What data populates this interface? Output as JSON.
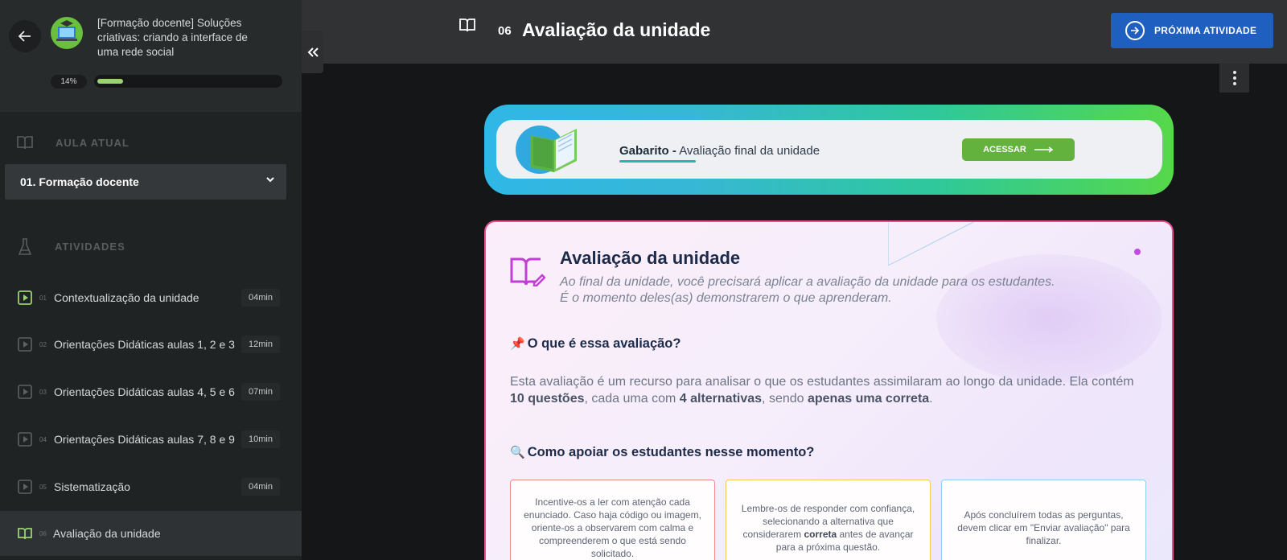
{
  "sidebar": {
    "course_title": "[Formação docente] Soluções criativas: criando a interface de uma rede social",
    "progress_label": "14%",
    "progress_value": 0.14,
    "current_lesson_heading": "AULA ATUAL",
    "current_lesson": "01. Formação docente",
    "activities_heading": "ATIVIDADES",
    "activities": [
      {
        "num": "01",
        "label": "Contextualização da unidade",
        "duration": "04min",
        "icon": "video-play-icon"
      },
      {
        "num": "02",
        "label": "Orientações Didáticas aulas 1, 2 e 3",
        "duration": "12min",
        "icon": "video-play-icon"
      },
      {
        "num": "03",
        "label": "Orientações Didáticas aulas 4, 5 e 6",
        "duration": "07min",
        "icon": "video-play-icon"
      },
      {
        "num": "04",
        "label": "Orientações Didáticas aulas 7, 8 e 9",
        "duration": "10min",
        "icon": "video-play-icon"
      },
      {
        "num": "05",
        "label": "Sistematização",
        "duration": "04min",
        "icon": "video-play-icon"
      },
      {
        "num": "06",
        "label": "Avaliação da unidade",
        "duration": "",
        "icon": "open-book-icon"
      }
    ]
  },
  "header": {
    "unit_number": "06",
    "unit_title": "Avaliação da unidade",
    "next_button": "PRÓXIMA ATIVIDADE"
  },
  "banner": {
    "bold": "Gabarito -",
    "text": "Avaliação final da unidade",
    "button": "ACESSAR"
  },
  "card": {
    "title": "Avaliação da unidade",
    "subtitle_line1": "Ao final da unidade, você precisará aplicar a avaliação da unidade para os estudantes.",
    "subtitle_line2": "É o momento deles(as) demonstrarem o que aprenderam.",
    "q1_emoji": "📌",
    "q1": "O que é essa avaliação?",
    "body_part1": "Esta avaliação é um recurso para analisar o que os estudantes assimilaram ao longo da unidade. Ela contém ",
    "body_bold1": "10 questões",
    "body_part2": ", cada uma com ",
    "body_bold2": "4 alternativas",
    "body_part3": ", sendo ",
    "body_bold3": "apenas uma correta",
    "body_part4": ".",
    "q2_emoji": "🔍",
    "q2": "Como apoiar os estudantes nesse momento?",
    "tip1": "Incentive-os a ler com atenção cada enunciado. Caso haja código ou imagem, oriente-os a observarem com calma e compreenderem o que está sendo solicitado.",
    "tip2_a": "Lembre-os de responder com confiança, selecionando a alternativa que considerarem ",
    "tip2_bold": "correta",
    "tip2_b": " antes de avançar para a próxima questão.",
    "tip3": "Após concluírem todas as perguntas, devem clicar em \"Enviar avaliação\" para finalizar."
  },
  "colors": {
    "accent_green": "#98d36b",
    "primary_blue": "#1f5fbf",
    "card_border": "#e9508f",
    "tip1_border": "#f08a8a",
    "tip2_border": "#f3cc55",
    "tip3_border": "#8fd0ee"
  }
}
